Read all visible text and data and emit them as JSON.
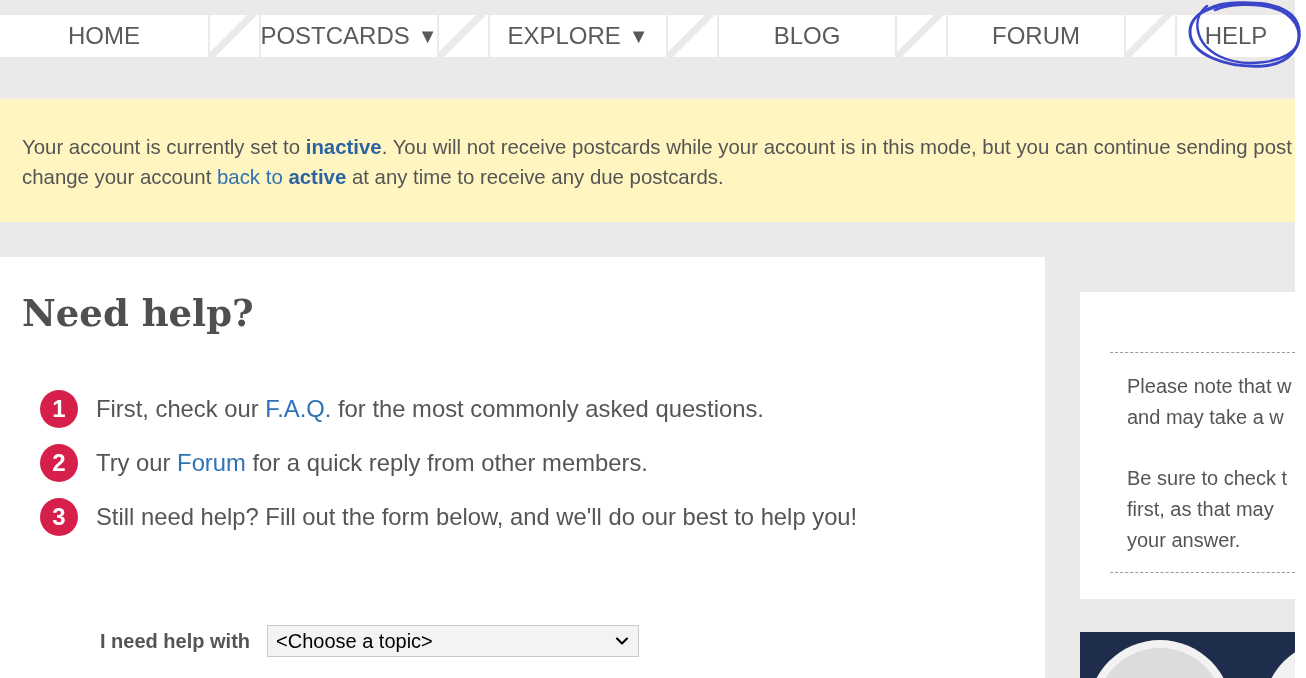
{
  "nav": [
    {
      "label": "HOME",
      "circled": false
    },
    {
      "label": "POSTCARDS",
      "caret": "▼",
      "circled": false
    },
    {
      "label": "EXPLORE",
      "caret": "▼",
      "circled": false
    },
    {
      "label": "BLOG",
      "circled": false
    },
    {
      "label": "FORUM",
      "circled": false
    },
    {
      "label": "HELP",
      "circled": true
    }
  ],
  "notice": {
    "lines": [
      [
        {
          "kind": "text",
          "text": "Your account is currently set to **inactive**. You will not receive postcards while your account is in this mode, but you can continue sending post"
        }
      ],
      [
        {
          "kind": "text",
          "text": "change your account "
        },
        {
          "kind": "link",
          "text": "back to **active**"
        },
        {
          "kind": "text",
          "text": " at any time to receive any due postcards."
        }
      ]
    ]
  },
  "help": {
    "title": "Need help?",
    "steps": [
      {
        "number": "1",
        "parts": [
          {
            "kind": "text",
            "text": "First, check our "
          },
          {
            "kind": "link",
            "text": "F.A.Q."
          },
          {
            "kind": "text",
            "text": " for the most commonly asked questions."
          }
        ]
      },
      {
        "number": "2",
        "parts": [
          {
            "kind": "text",
            "text": "Try our "
          },
          {
            "kind": "link",
            "text": "Forum"
          },
          {
            "kind": "text",
            "text": " for a quick reply from other members."
          }
        ]
      },
      {
        "number": "3",
        "parts": [
          {
            "kind": "text",
            "text": "Still need help? Fill out the form below, and we'll do our best to help you!"
          }
        ]
      }
    ],
    "form": {
      "label": "I need help with",
      "topic_select": {
        "value": "<Choose a topic>"
      }
    }
  },
  "sidebar": {
    "paragraphs": [
      [
        "Please note that w",
        "and may take a w"
      ],
      [
        "Be sure to check t",
        "first, as that may",
        "your answer."
      ]
    ]
  }
}
